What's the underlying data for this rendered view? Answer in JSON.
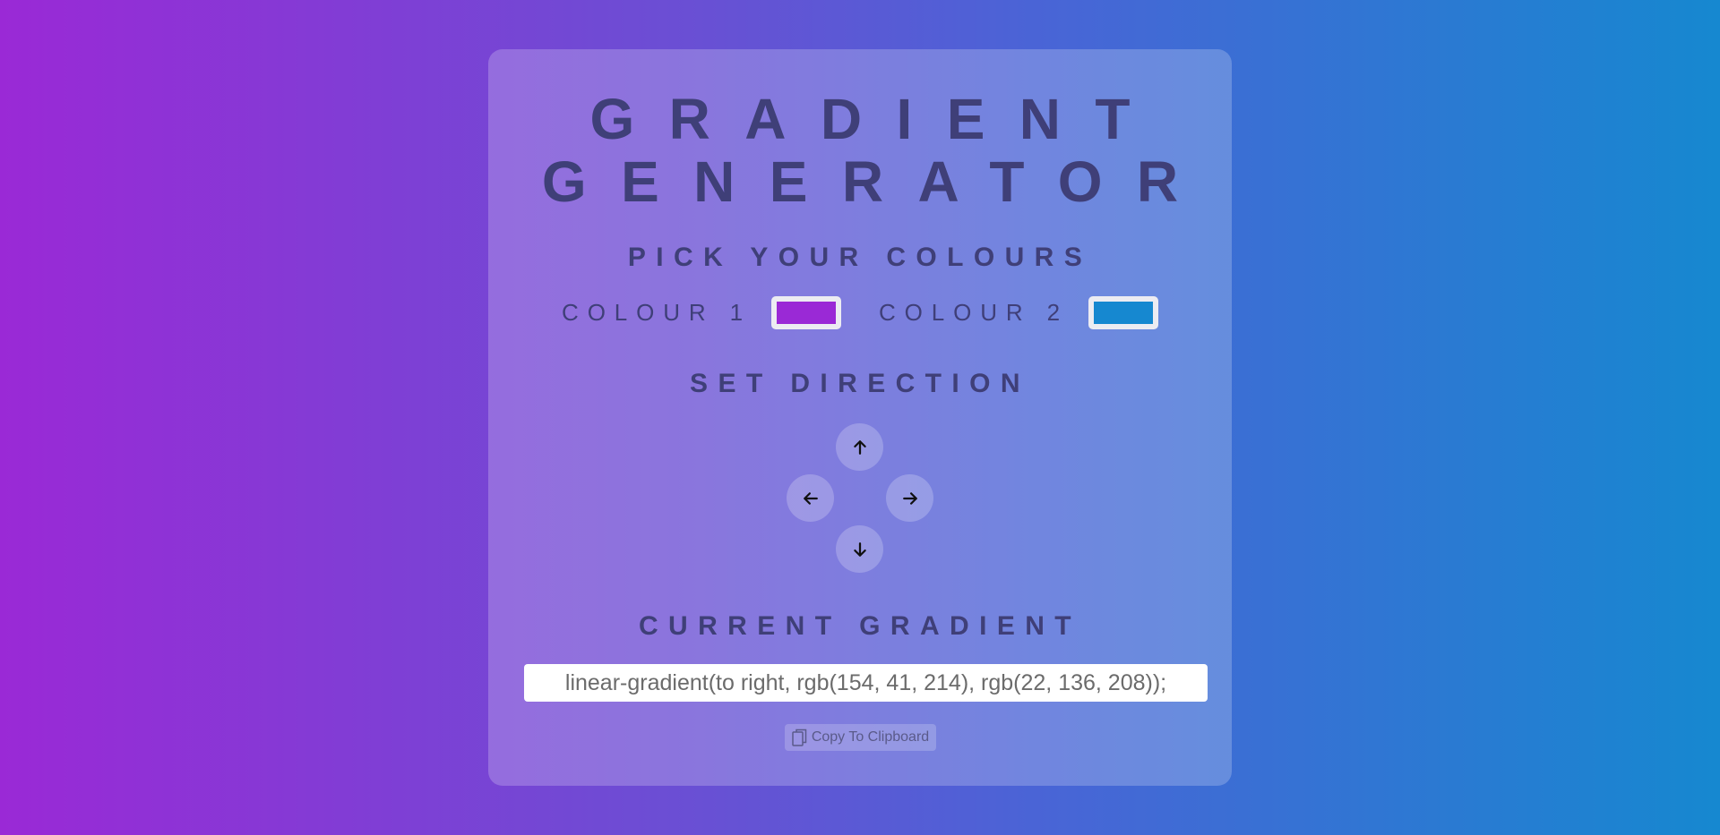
{
  "title": {
    "line1": "GRADIENT",
    "line2": "GENERATOR"
  },
  "headings": {
    "pick": "PICK YOUR COLOURS",
    "direction": "SET DIRECTION",
    "current": "CURRENT GRADIENT"
  },
  "colours": {
    "colour1_label": "COLOUR 1",
    "colour1_value": "#9a29d6",
    "colour2_label": "COLOUR 2",
    "colour2_value": "#1688d0"
  },
  "directions": {
    "up_icon": "arrow-up-icon",
    "left_icon": "arrow-left-icon",
    "right_icon": "arrow-right-icon",
    "down_icon": "arrow-down-icon"
  },
  "output": {
    "css_value": "linear-gradient(to right, rgb(154, 41, 214), rgb(22, 136, 208));"
  },
  "copy": {
    "label": "Copy To Clipboard",
    "icon": "clipboard-copy-icon"
  }
}
